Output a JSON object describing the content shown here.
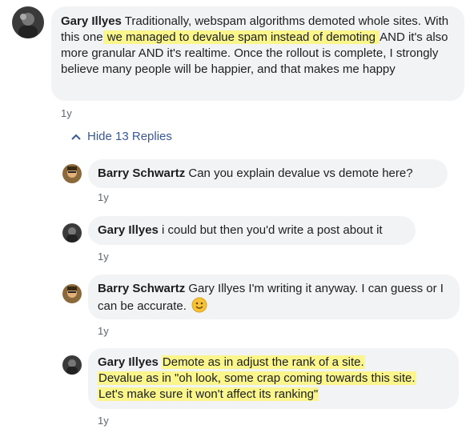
{
  "thread": {
    "main": {
      "author": "Gary Illyes",
      "text_before": " Traditionally, webspam algorithms demoted whole sites. With this one",
      "text_highlight": " we managed to devalue spam instead of demoting ",
      "text_after": "AND it's also more granular AND it's realtime. Once the rollout is complete, I strongly believe many people will be happier, and that makes me happy",
      "time": "1y"
    },
    "toggle_label": "Hide 13 Replies",
    "replies": [
      {
        "author": "Barry Schwartz",
        "text": " Can you explain devalue vs demote here?",
        "time": "1y"
      },
      {
        "author": "Gary Illyes",
        "text": " i could but then you'd write a post about it",
        "time": "1y"
      },
      {
        "author": "Barry Schwartz",
        "text": " Gary Illyes I'm writing it anyway. I can guess or I can be accurate. ",
        "emoji": "smiley-emoji",
        "time": "1y"
      },
      {
        "author": "Gary Illyes",
        "highlight_line1": "Demote as in adjust the rank of a site.",
        "highlight_line2": "Devalue as in \"oh look, some crap coming towards this site.",
        "highlight_line3": "Let's make sure it won't affect its ranking\"",
        "time": "1y"
      }
    ]
  },
  "colors": {
    "bubble_bg": "#f2f3f5",
    "highlight": "#fbf68c",
    "link": "#385898",
    "meta": "#606770"
  },
  "icons": {
    "toggle": "chevron-up-icon"
  }
}
